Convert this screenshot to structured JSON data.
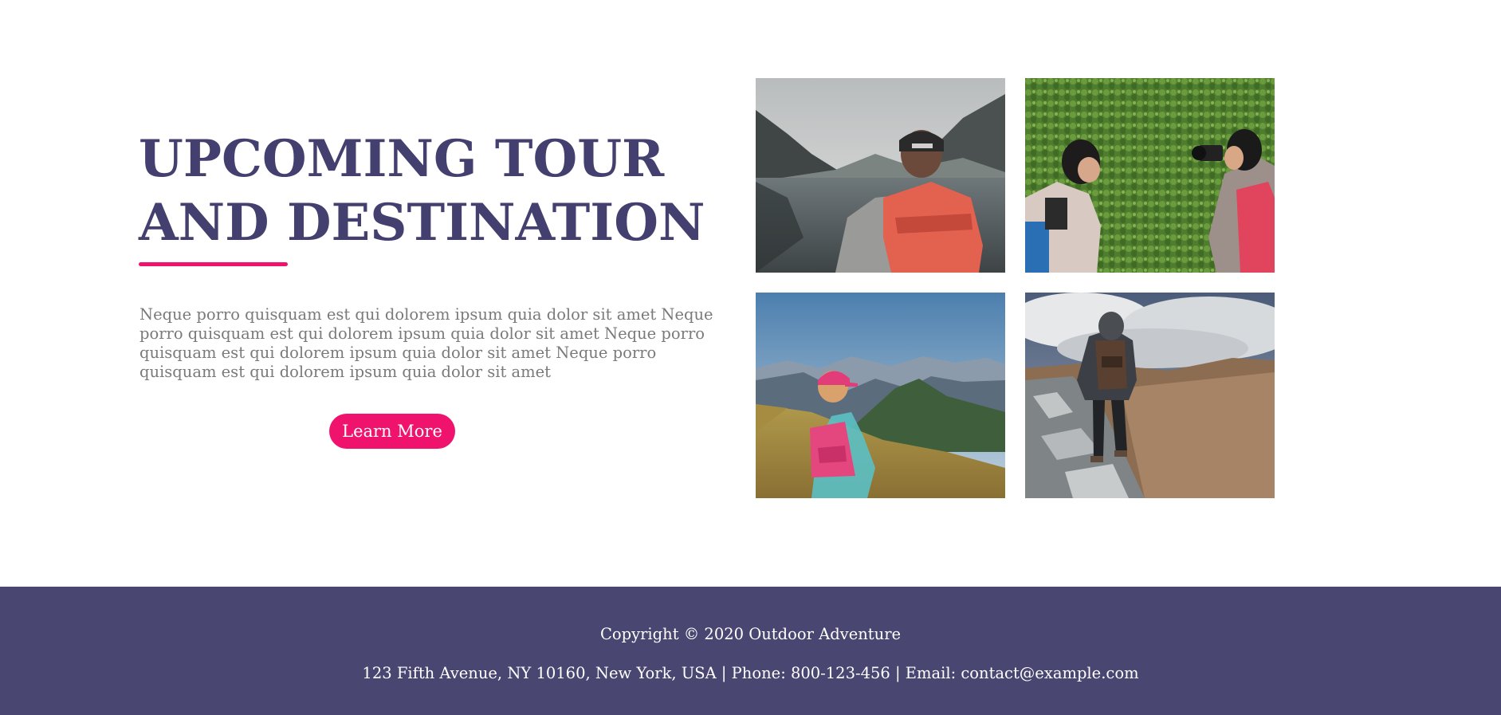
{
  "hero": {
    "heading": "UPCOMING TOUR\nAND DESTINATION",
    "paragraph": "Neque porro quisquam est qui dolorem ipsum quia dolor sit amet Neque porro quisquam est qui dolorem ipsum quia dolor sit amet Neque porro quisquam est qui dolorem ipsum quia dolor sit amet Neque porro quisquam est qui dolorem ipsum quia dolor sit amet",
    "button_label": "Learn More"
  },
  "gallery": {
    "photos": [
      {
        "subject": "hiker with orange backpack at mountain lake"
      },
      {
        "subject": "two photographers with cameras on green ivy wall"
      },
      {
        "subject": "child with pink backpack sitting on grassy mountain slope"
      },
      {
        "subject": "hiker walking on rocky ridge under cloudy sky"
      }
    ]
  },
  "footer": {
    "copyright": "Copyright © 2020 Outdoor Adventure",
    "contact": "123 Fifth Avenue, NY 10160, New York, USA | Phone: 800-123-456 | Email: contact@example.com"
  },
  "colors": {
    "heading": "#433f6f",
    "accent": "#f0136d",
    "paragraph": "#7a7a7a",
    "footer_bg": "#4a4672",
    "footer_text": "#ffffff"
  }
}
